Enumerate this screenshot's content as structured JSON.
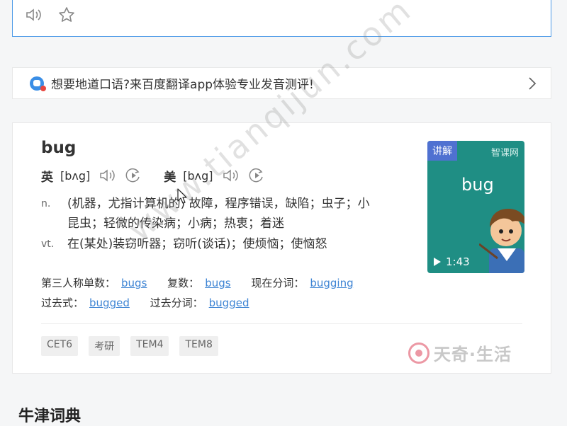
{
  "promo": {
    "text": "想要地道口语?来百度翻译app体验专业发音测评!"
  },
  "entry": {
    "word": "bug",
    "phonetics": [
      {
        "lang": "英",
        "ipa": "[bʌg]"
      },
      {
        "lang": "美",
        "ipa": "[bʌg]"
      }
    ],
    "definitions": [
      {
        "pos": "n.",
        "meaning": "(机器，尤指计算机的) 故障，程序错误，缺陷；虫子；小昆虫；轻微的传染病；小病；热衷；着迷"
      },
      {
        "pos": "vt.",
        "meaning": "在(某处)装窃听器；窃听(谈话)；使烦恼；使恼怒"
      }
    ],
    "forms": {
      "third_person_label": "第三人称单数：",
      "third_person": "bugs",
      "plural_label": "复数：",
      "plural": "bugs",
      "present_participle_label": "现在分词：",
      "present_participle": "bugging",
      "past_label": "过去式：",
      "past": "bugged",
      "past_participle_label": "过去分词：",
      "past_participle": "bugged"
    },
    "tags": [
      "CET6",
      "考研",
      "TEM4",
      "TEM8"
    ]
  },
  "video": {
    "badge": "讲解",
    "course": "智课网",
    "word": "bug",
    "duration": "1:43"
  },
  "brand": {
    "name": "天奇·生活"
  },
  "watermark": "www.tianqijun.com",
  "section": {
    "title": "牛津词典"
  },
  "colors": {
    "link": "#3f85d4",
    "input_border": "#4e9be8",
    "video_bg": "#1f8e84",
    "badge": "#4f71d1"
  },
  "icons": [
    "speaker-icon",
    "star-icon",
    "chevron-right-icon",
    "play-slow-icon",
    "play-icon"
  ]
}
